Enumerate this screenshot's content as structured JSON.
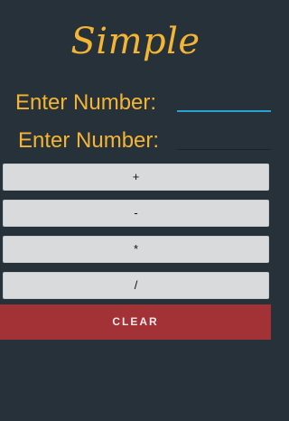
{
  "app": {
    "title": "Simple"
  },
  "form": {
    "first_label": "Enter Number:",
    "first_value": "",
    "second_label": "Enter Number:",
    "second_value": ""
  },
  "operations": {
    "add_label": "+",
    "subtract_label": "-",
    "multiply_label": "*",
    "divide_label": "/"
  },
  "actions": {
    "clear_label": "CLEAR"
  },
  "colors": {
    "background": "#27313a",
    "accent": "#f3b533",
    "focus_underline": "#29a3d6",
    "button_bg": "#d9dadb",
    "clear_bg": "#a33237"
  }
}
